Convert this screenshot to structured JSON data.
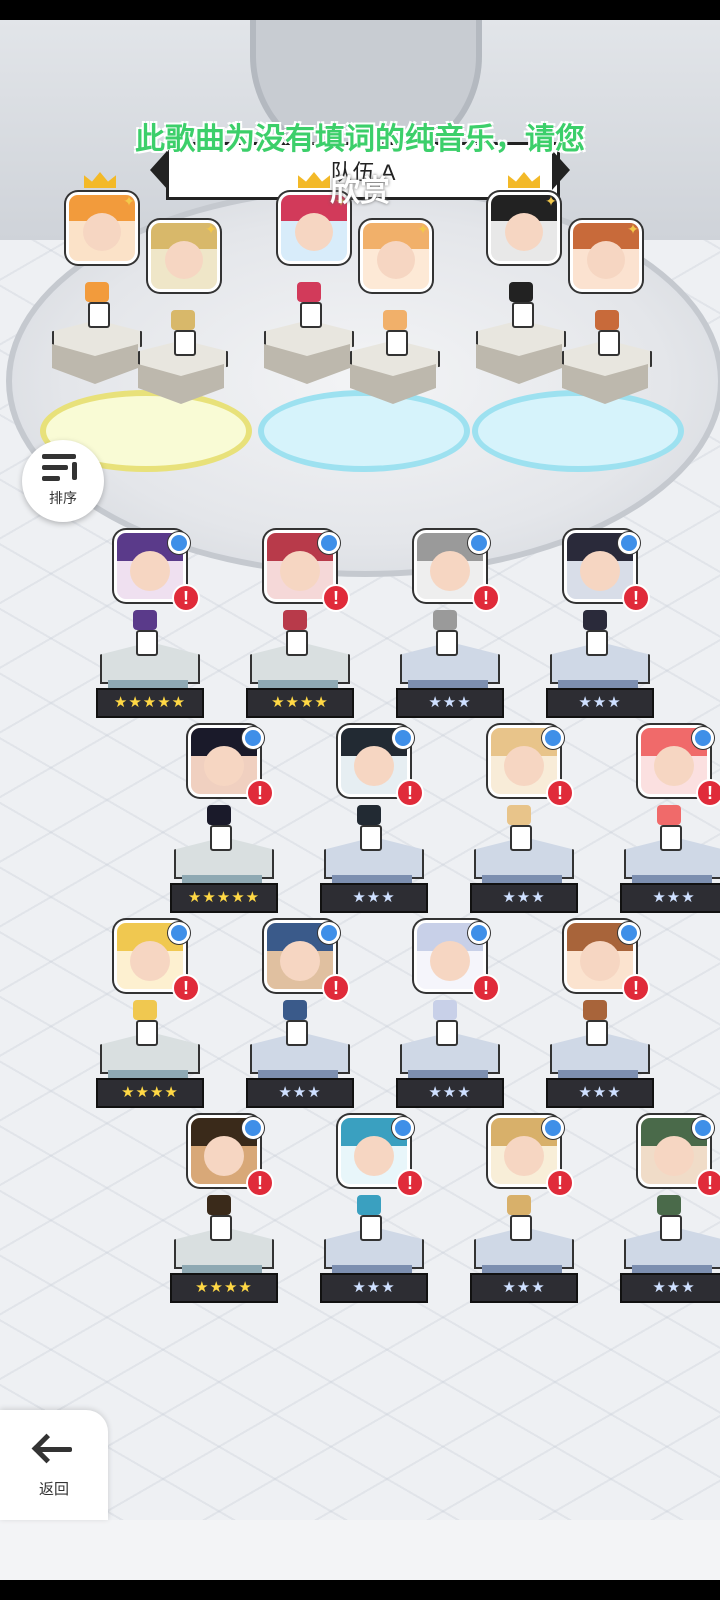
{
  "lyric": {
    "line1": "此歌曲为没有填词的纯音乐，请您",
    "line2": "欣赏"
  },
  "team": {
    "label": "队伍 A"
  },
  "sort_button": {
    "label": "排序",
    "icon": "sort-icon"
  },
  "back_button": {
    "label": "返回",
    "icon": "back-arrow-icon"
  },
  "heroes": [
    {
      "stars": "★★★★★",
      "star_color": "gold"
    },
    {
      "stars": "★★★★",
      "star_color": "gold"
    },
    {
      "stars": "★★★",
      "star_color": "silver"
    },
    {
      "stars": "★★★",
      "star_color": "silver"
    },
    {
      "stars": "★★★★★",
      "star_color": "gold"
    },
    {
      "stars": "★★★",
      "star_color": "silver"
    },
    {
      "stars": "★★★",
      "star_color": "silver"
    },
    {
      "stars": "★★★",
      "star_color": "silver"
    },
    {
      "stars": "★★★★",
      "star_color": "gold"
    },
    {
      "stars": "★★★",
      "star_color": "silver"
    },
    {
      "stars": "★★★",
      "star_color": "silver"
    },
    {
      "stars": "★★★",
      "star_color": "silver"
    },
    {
      "stars": "★★★★",
      "star_color": "gold"
    },
    {
      "stars": "★★★",
      "star_color": "silver"
    },
    {
      "stars": "★★★",
      "star_color": "silver"
    },
    {
      "stars": "★★★",
      "star_color": "silver"
    }
  ],
  "hero_badges": {
    "alert": "!"
  },
  "colors": {
    "lyric": "#3ccf6a",
    "alert": "#e02b3a",
    "info_dot": "#3f8fe8",
    "crown": "#f3b928"
  }
}
